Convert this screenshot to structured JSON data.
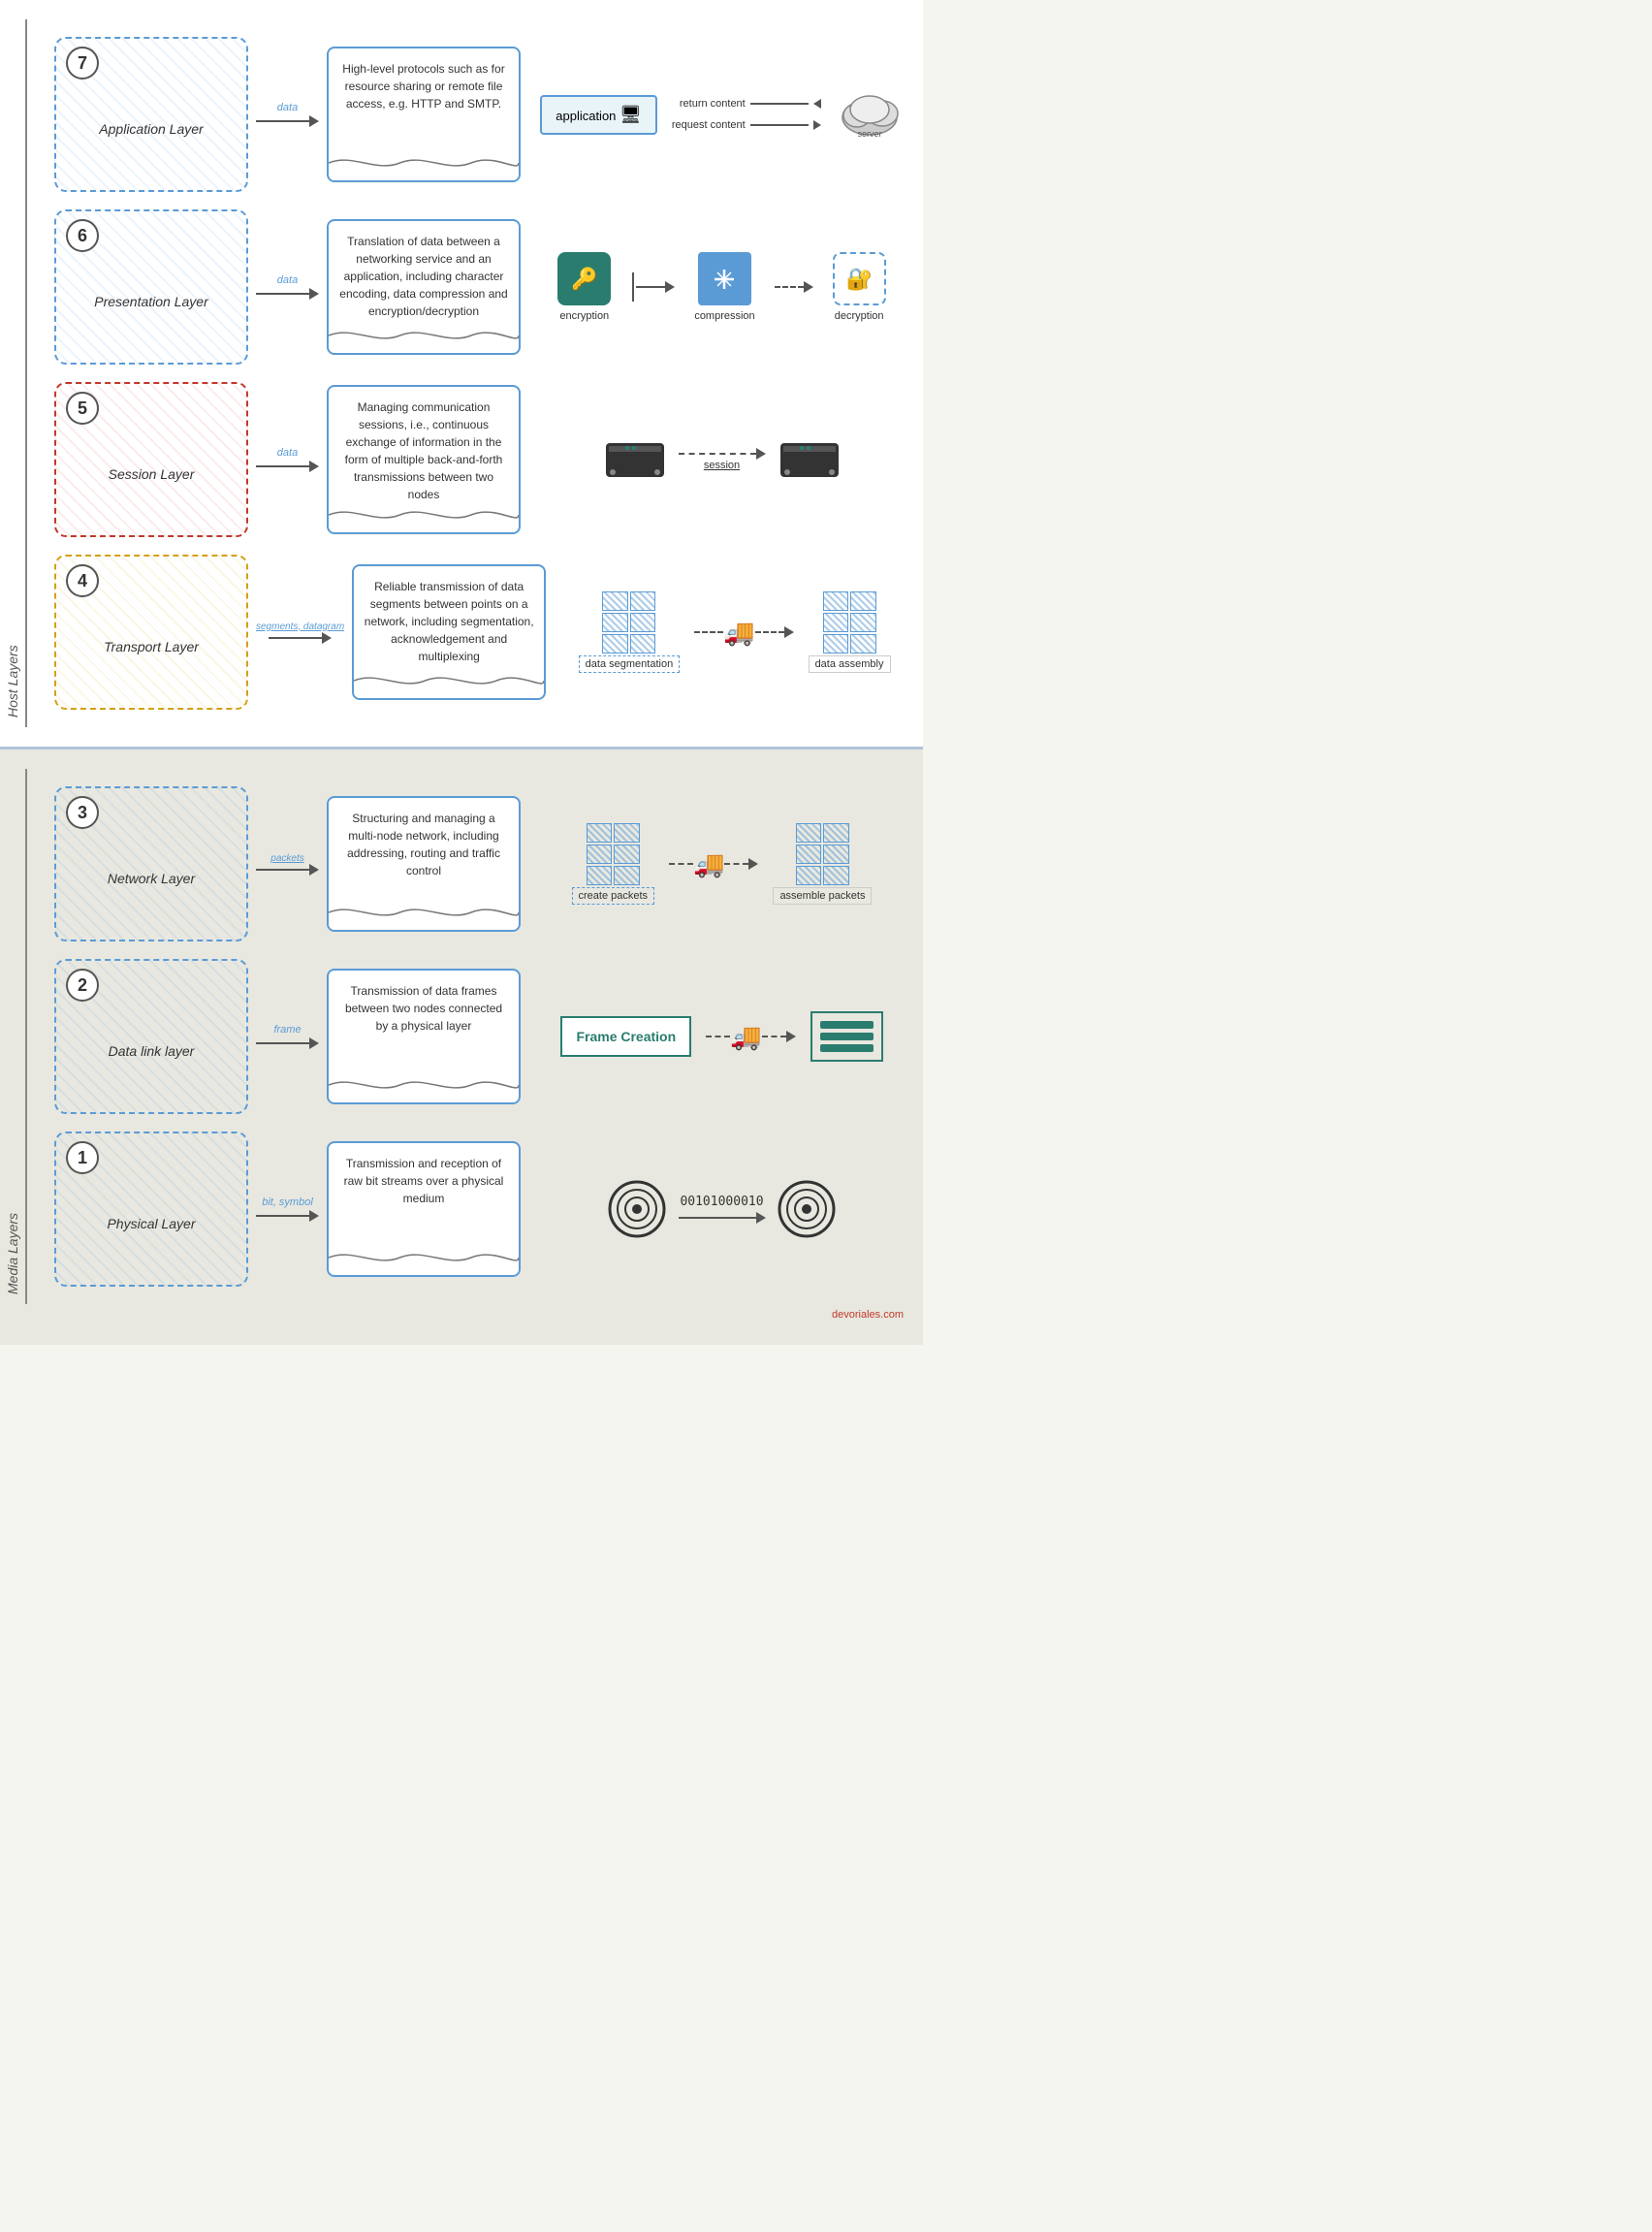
{
  "layers": [
    {
      "num": "7",
      "name": "Application Layer",
      "data_label": "data",
      "description": "High-level protocols such as for resource sharing or remote file access, e.g. HTTP and SMTP.",
      "box_style": "default",
      "diagram_type": "application"
    },
    {
      "num": "6",
      "name": "Presentation Layer",
      "data_label": "data",
      "description": "Translation of data between a networking service and an application, including character encoding, data compression and encryption/decryption",
      "box_style": "default",
      "diagram_type": "presentation",
      "diagram_labels": [
        "encryption",
        "compression",
        "decryption"
      ]
    },
    {
      "num": "5",
      "name": "Session Layer",
      "data_label": "data",
      "description": "Managing communication sessions, i.e., continuous exchange of information in the form of multiple back-and-forth transmissions between two nodes",
      "box_style": "session",
      "diagram_type": "session",
      "diagram_labels": [
        "session"
      ]
    },
    {
      "num": "4",
      "name": "Transport Layer",
      "data_label": "segments, datagram",
      "description": "Reliable transmission of data segments between points on a network, including segmentation, acknowledgement and multiplexing",
      "box_style": "transport",
      "diagram_type": "transport",
      "diagram_labels": [
        "data segmentation",
        "data assembly"
      ]
    }
  ],
  "media_layers": [
    {
      "num": "3",
      "name": "Network Layer",
      "data_label": "packets",
      "description": "Structuring and managing a multi-node network, including addressing, routing and traffic control",
      "box_style": "default",
      "diagram_type": "network",
      "diagram_labels": [
        "create packets",
        "assemble packets"
      ]
    },
    {
      "num": "2",
      "name": "Data link layer",
      "data_label": "frame",
      "description": "Transmission of data frames between two nodes connected by a physical layer",
      "box_style": "default",
      "diagram_type": "datalink",
      "diagram_labels": [
        "Frame Creation"
      ]
    },
    {
      "num": "1",
      "name": "Physical Layer",
      "data_label": "bit, symbol",
      "description": "Transmission and reception of raw bit streams over a physical medium",
      "box_style": "default",
      "diagram_type": "physical",
      "diagram_labels": [
        "00101000010"
      ]
    }
  ],
  "section_labels": {
    "host": "Host Layers",
    "media": "Media Layers"
  },
  "app_diagram": {
    "app_box": "application",
    "return_label": "return content",
    "request_label": "request content"
  },
  "credit": "devoriales.com"
}
